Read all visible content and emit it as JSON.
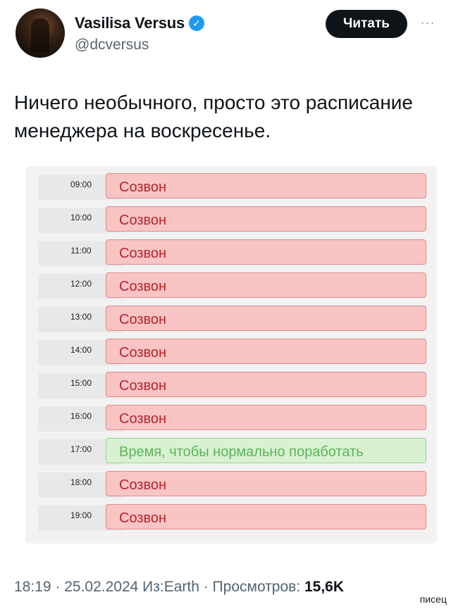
{
  "header": {
    "display_name": "Vasilisa Versus",
    "handle": "@dcversus",
    "follow_label": "Читать",
    "more_glyph": "···",
    "verified_glyph": "✓"
  },
  "tweet": {
    "text": "Ничего необычного, просто это расписание менеджера на воскресенье."
  },
  "schedule": {
    "rows": [
      {
        "time": "09:00",
        "event": "Созвон",
        "status": "busy"
      },
      {
        "time": "10:00",
        "event": "Созвон",
        "status": "busy"
      },
      {
        "time": "11:00",
        "event": "Созвон",
        "status": "busy"
      },
      {
        "time": "12:00",
        "event": "Созвон",
        "status": "busy"
      },
      {
        "time": "13:00",
        "event": "Созвон",
        "status": "busy"
      },
      {
        "time": "14:00",
        "event": "Созвон",
        "status": "busy"
      },
      {
        "time": "15:00",
        "event": "Созвон",
        "status": "busy"
      },
      {
        "time": "16:00",
        "event": "Созвон",
        "status": "busy"
      },
      {
        "time": "17:00",
        "event": "Время, чтобы нормально поработать",
        "status": "free"
      },
      {
        "time": "18:00",
        "event": "Созвон",
        "status": "busy"
      },
      {
        "time": "19:00",
        "event": "Созвон",
        "status": "busy"
      }
    ]
  },
  "footer": {
    "meta": "18:19 · 25.02.2024 Из:Earth · Просмотров:",
    "views": "15,6K"
  },
  "watermark": "писец",
  "colors": {
    "busy_bg": "#f9c4c4",
    "busy_text": "#b8232a",
    "free_bg": "#d8f1d2",
    "free_text": "#5bb557",
    "verified": "#1d9bf0"
  }
}
